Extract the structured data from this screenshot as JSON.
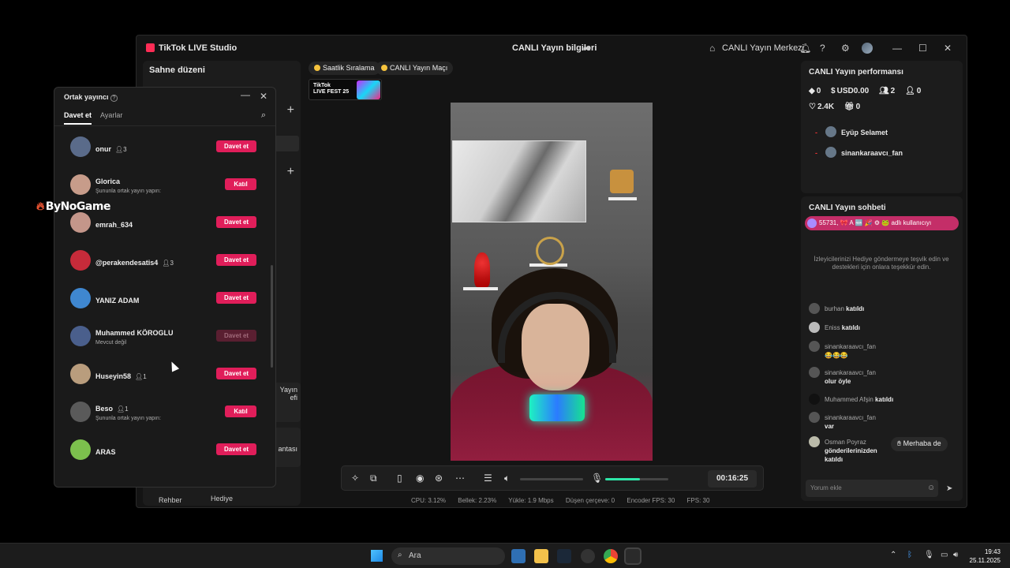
{
  "window": {
    "app_title": "TikTok LIVE Studio",
    "center_title": "CANLI Yayın bilgileri",
    "hub_label": "CANLI Yayın Merkezi"
  },
  "left_panel": {
    "title": "Sahne düzeni",
    "tool_label_1a": "Yayın",
    "tool_label_1b": "efi",
    "tool_label_2": "antası",
    "bottom_tab_1": "Rehber",
    "bottom_tab_2": "Hediye"
  },
  "stage": {
    "chip_1": "Saatlik Sıralama",
    "chip_2": "CANLI Yayın Maçı",
    "fest_line1": "TikTok",
    "fest_line2": "LIVE FEST 25"
  },
  "controls": {
    "timer": "00:16:25",
    "volume_level": 0.0,
    "mic_level": 0.55
  },
  "stats": {
    "cpu": "CPU:  3.12%",
    "memory": "Bellek:  2.23%",
    "upload": "Yükle:  1.9 Mbps",
    "dropped": "Düşen çerçeve:  0",
    "encoder": "Encoder FPS:  30",
    "fps": "FPS:  30"
  },
  "performance": {
    "title": "CANLI Yayın performansı",
    "diamonds": "0",
    "usd": "USD0.00",
    "viewers": "2",
    "new_followers": "0",
    "likes": "2.4K",
    "gifts": "0",
    "viewer_list": [
      "Eyüp Selamet",
      "sinankaraavcı_fan"
    ]
  },
  "chat": {
    "title": "CANLI Yayın sohbeti",
    "pinned": "55731, 🎀 A 🆕 🎉 ⚙ 🐸 adlı kullanıcıyı",
    "tip": "İzleyicilerinizi Hediye göndermeye teşvik edin ve destekleri için onlara teşekkür edin.",
    "messages": [
      {
        "user": "burhan",
        "text": "katıldı"
      },
      {
        "user": "Eniss",
        "text": "katıldı"
      },
      {
        "user": "sinankaraavcı_fan",
        "text": "😂😂😂"
      },
      {
        "user": "sinankaraavcı_fan",
        "text": "olur öyle"
      },
      {
        "user": "Muhammed Afşin",
        "text": "katıldı"
      },
      {
        "user": "sinankaraavcı_fan",
        "text": "var"
      },
      {
        "user": "Osman Poyraz",
        "text": "gönderilerinizden katıldı"
      }
    ],
    "hello_button": "Merhaba de",
    "comment_placeholder": "Yorum ekle"
  },
  "cohost": {
    "title": "Ortak yayıncı",
    "tab_invite": "Davet et",
    "tab_settings": "Ayarlar",
    "items": [
      {
        "name": "onur",
        "count": "3",
        "sub": "",
        "button": "Davet et"
      },
      {
        "name": "Glorica",
        "count": "",
        "sub": "Şununla ortak yayın yapın:",
        "button": "Katıl"
      },
      {
        "name": "emrah_634",
        "count": "",
        "sub": "",
        "button": "Davet et"
      },
      {
        "name": "@perakendesatis4",
        "count": "3",
        "sub": "",
        "button": "Davet et"
      },
      {
        "name": "YANIZ ADAM",
        "count": "",
        "sub": "",
        "button": "Davet et"
      },
      {
        "name": "Muhammed KÖROGLU",
        "count": "",
        "sub": "Mevcut değil",
        "button": "Davet et"
      },
      {
        "name": "Huseyin58",
        "count": "1",
        "sub": "",
        "button": "Davet et"
      },
      {
        "name": "Beso",
        "count": "1",
        "sub": "Şununla ortak yayın yapın:",
        "button": "Katıl"
      },
      {
        "name": "ARAS",
        "count": "",
        "sub": "",
        "button": "Davet et"
      }
    ]
  },
  "watermark": "ByNoGame",
  "taskbar": {
    "search_placeholder": "Ara",
    "time": "19:43",
    "date": "25.11.2025"
  },
  "colors": {
    "accent": "#e01e5a",
    "tiktok_red": "#fe2c55",
    "mic_level": "#2ee6a8"
  }
}
